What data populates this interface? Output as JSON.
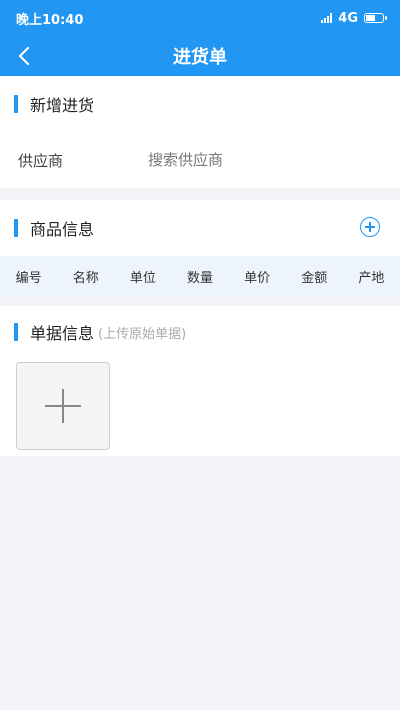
{
  "status": {
    "time": "晚上10:40",
    "network": "4G"
  },
  "navbar": {
    "title": "进货单"
  },
  "new_purchase": {
    "title": "新增进货",
    "supplier_label": "供应商",
    "supplier_placeholder": "搜索供应商",
    "supplier_value": ""
  },
  "goods": {
    "title": "商品信息",
    "columns": [
      "编号",
      "名称",
      "单位",
      "数量",
      "单价",
      "金额",
      "产地"
    ]
  },
  "receipt": {
    "title": "单据信息",
    "hint": "(上传原始单据)"
  },
  "colors": {
    "primary": "#2196f3",
    "background": "#f4f4f8",
    "table_header_bg": "#eef4fc"
  },
  "icons": {
    "back": "chevron-left-icon",
    "add_goods": "plus-circle-icon",
    "upload": "plus-icon"
  }
}
